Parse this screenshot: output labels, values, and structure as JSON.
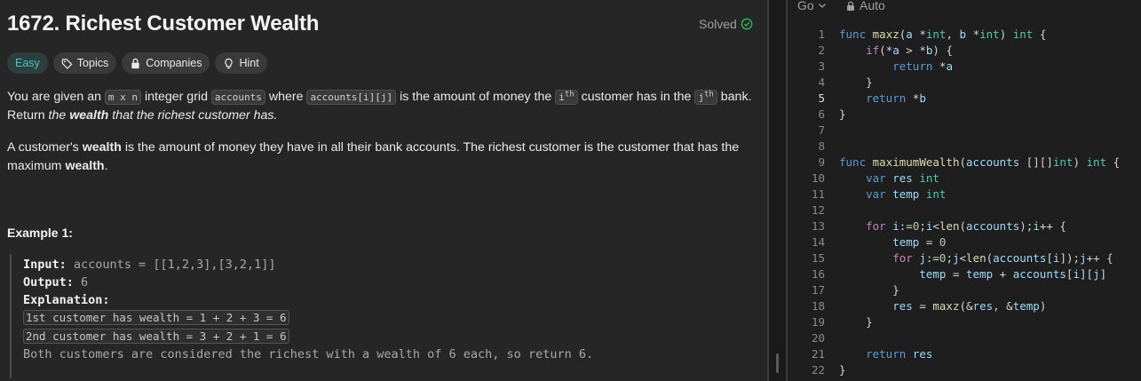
{
  "problem": {
    "title": "1672. Richest Customer Wealth",
    "status": "Solved",
    "tags": [
      {
        "label": "Easy",
        "icon": ""
      },
      {
        "label": "Topics",
        "icon": "tag-icon"
      },
      {
        "label": "Companies",
        "icon": "lock-icon"
      },
      {
        "label": "Hint",
        "icon": "lightbulb-icon"
      }
    ],
    "description": {
      "p1_a": "You are given an ",
      "p1_code1": "m x n",
      "p1_b": " integer grid ",
      "p1_code2": "accounts",
      "p1_c": " where ",
      "p1_code3": "accounts[i][j]",
      "p1_d": " is the amount of money the ",
      "p1_code4": "i",
      "p1_sup1": "th",
      "p1_e": " customer has in the ",
      "p1_code5": "j",
      "p1_sup2": "th",
      "p1_f": " bank.",
      "p1_line2_a": "Return ",
      "p1_line2_italic_a": "the ",
      "p1_line2_bold": "wealth",
      "p1_line2_italic_b": " that the richest customer has.",
      "p2_a": "A customer's ",
      "p2_bold1": "wealth",
      "p2_b": " is the amount of money they have in all their bank accounts. The richest customer is the customer that has the",
      "p2_c": "maximum ",
      "p2_bold2": "wealth",
      "p2_d": "."
    },
    "example": {
      "title": "Example 1:",
      "input_label": "Input:",
      "input_value": " accounts = [[1,2,3],[3,2,1]]",
      "output_label": "Output:",
      "output_value": " 6",
      "explanation_label": "Explanation:",
      "lines": [
        "1st customer has wealth = 1 + 2 + 3 = 6",
        "2nd customer has wealth = 3 + 2 + 1 = 6"
      ],
      "conclusion": "Both customers are considered the richest with a wealth of 6 each, so return 6."
    }
  },
  "editor": {
    "language": "Go",
    "mode": "Auto",
    "active_line": 5,
    "line_numbers": [
      "1",
      "2",
      "3",
      "4",
      "5",
      "6",
      "7",
      "8",
      "9",
      "10",
      "11",
      "12",
      "13",
      "14",
      "15",
      "16",
      "17",
      "18",
      "19",
      "20",
      "21",
      "22"
    ],
    "code_lines": [
      "func maxz(a *int, b *int) int {",
      "    if(*a > *b) {",
      "        return *a",
      "    }",
      "    return *b",
      "}",
      "",
      "",
      "func maximumWealth(accounts [][]int) int {",
      "    var res int",
      "    var temp int",
      "",
      "    for i:=0;i<len(accounts);i++ {",
      "        temp = 0",
      "        for j:=0;j<len(accounts[i]);j++ {",
      "            temp = temp + accounts[i][j]",
      "        }",
      "        res = maxz(&res, &temp)",
      "    }",
      "",
      "    return res",
      "}"
    ]
  },
  "colors": {
    "accent_easy": "#46c6c2",
    "solved_check": "#2cbb5d",
    "panel_bg": "#262626",
    "editor_bg": "#1e1e1e"
  }
}
